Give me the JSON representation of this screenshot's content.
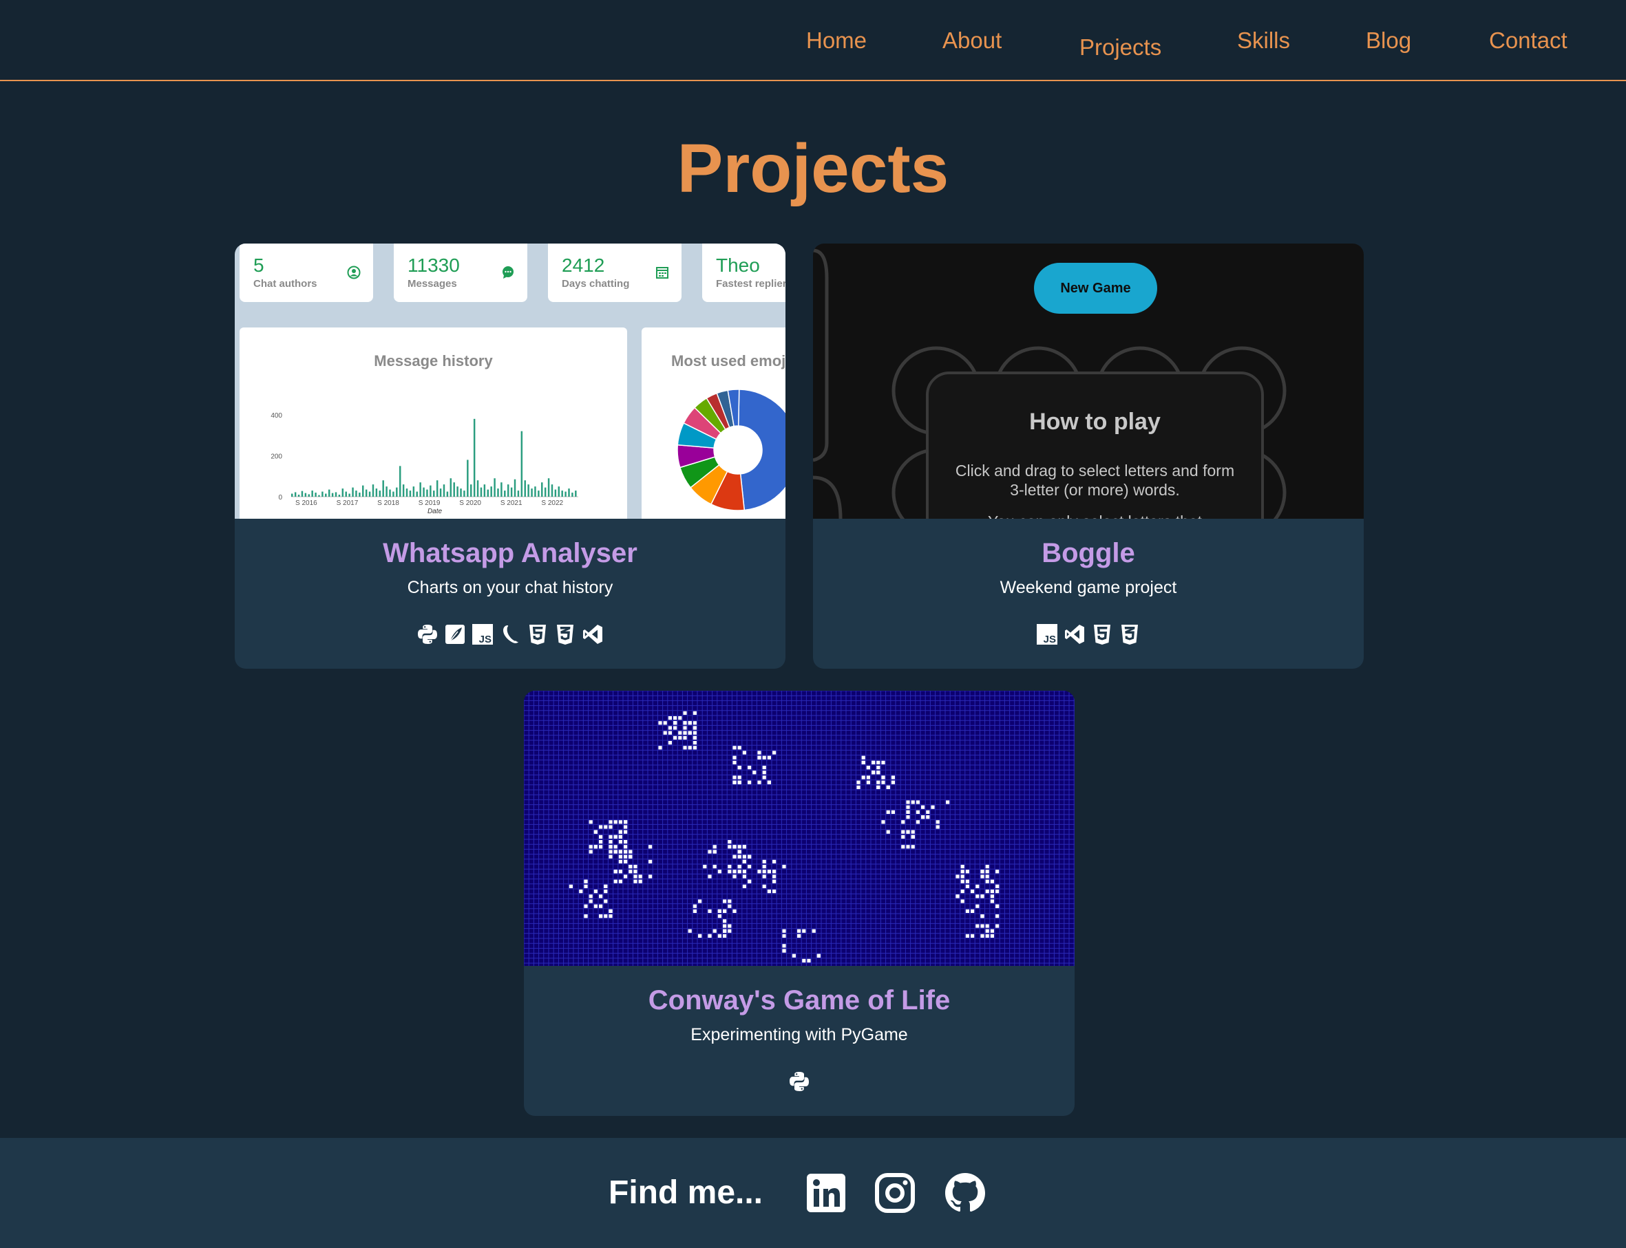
{
  "nav": {
    "items": [
      {
        "label": "Home"
      },
      {
        "label": "About"
      },
      {
        "label": "Projects"
      },
      {
        "label": "Skills"
      },
      {
        "label": "Blog"
      },
      {
        "label": "Contact"
      }
    ]
  },
  "page": {
    "title": "Projects"
  },
  "projects": [
    {
      "title": "Whatsapp Analyser",
      "subtitle": "Charts on your chat history",
      "tech_icons": [
        "python-icon",
        "feather-icon",
        "javascript-icon",
        "flask-icon",
        "html5-icon",
        "css3-icon",
        "vscode-icon"
      ],
      "preview": {
        "stats": [
          {
            "value": "5",
            "label": "Chat authors",
            "icon": "user-icon"
          },
          {
            "value": "11330",
            "label": "Messages",
            "icon": "chat-icon"
          },
          {
            "value": "2412",
            "label": "Days chatting",
            "icon": "calendar-icon"
          },
          {
            "value": "Theo",
            "label": "Fastest replier",
            "icon": ""
          }
        ],
        "history_title": "Message history",
        "history_chart": {
          "type": "bar",
          "xlabel": "Date",
          "yticks": [
            "400",
            "200",
            "0"
          ],
          "xticks": [
            "S 2016",
            "S 2017",
            "S 2018",
            "S 2019",
            "S 2020",
            "S 2021",
            "S 2022"
          ],
          "ylim": [
            0,
            450
          ],
          "values": [
            15,
            22,
            10,
            28,
            18,
            12,
            30,
            20,
            8,
            25,
            15,
            35,
            18,
            22,
            10,
            40,
            25,
            15,
            45,
            30,
            20,
            55,
            35,
            25,
            60,
            40,
            30,
            80,
            50,
            35,
            25,
            45,
            150,
            60,
            40,
            30,
            50,
            25,
            70,
            45,
            35,
            55,
            30,
            80,
            40,
            60,
            25,
            90,
            70,
            50,
            40,
            30,
            180,
            60,
            380,
            80,
            45,
            60,
            35,
            50,
            90,
            40,
            70,
            30,
            60,
            45,
            85,
            30,
            320,
            80,
            60,
            40,
            50,
            30,
            70,
            45,
            90,
            60,
            35,
            50,
            30,
            25,
            40,
            20,
            30
          ],
          "color": "#2a9d7f"
        },
        "emoji_title": "Most used emojis",
        "emoji_chart": {
          "type": "pie",
          "values": [
            48,
            9,
            7,
            6,
            6,
            6,
            5,
            4,
            3,
            3,
            3
          ],
          "colors": [
            "#3366cc",
            "#dc3912",
            "#ff9900",
            "#109618",
            "#990099",
            "#0099c6",
            "#dd4477",
            "#66aa00",
            "#b82e2e",
            "#316395",
            "#3366cc"
          ]
        }
      }
    },
    {
      "title": "Boggle",
      "subtitle": "Weekend game project",
      "tech_icons": [
        "javascript-icon",
        "vscode-icon",
        "html5-icon",
        "css3-icon"
      ],
      "preview": {
        "button": "New Game",
        "howto_title": "How to play",
        "howto_text": "Click and drag to select letters and form 3-letter (or more) words.",
        "howto_text2": "You can only select letters that"
      }
    },
    {
      "title": "Conway's Game of Life",
      "subtitle": "Experimenting with PyGame",
      "tech_icons": [
        "python-icon"
      ],
      "preview": {
        "background": "#0c0070",
        "cell_color": "#ffffff"
      }
    }
  ],
  "footer": {
    "label": "Find me...",
    "socials": [
      "linkedin-icon",
      "instagram-icon",
      "github-icon"
    ]
  },
  "colors": {
    "accent": "#e8934f",
    "card_title": "#c49be6",
    "card_bg": "#1f3749",
    "page_bg": "#152532"
  }
}
